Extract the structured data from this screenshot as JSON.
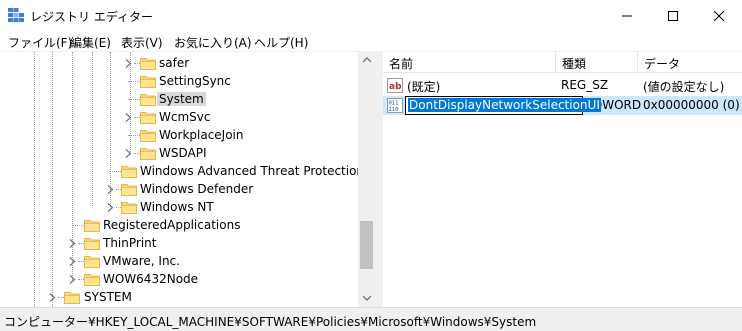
{
  "window": {
    "title": "レジストリ エディター"
  },
  "menu": [
    "ファイル(F)",
    "編集(E)",
    "表示(V)",
    "お気に入り(A)",
    "ヘルプ(H)"
  ],
  "tree": {
    "nodes": [
      {
        "label": "safer",
        "expandable": true,
        "selected": false
      },
      {
        "label": "SettingSync",
        "expandable": false,
        "selected": false
      },
      {
        "label": "System",
        "expandable": false,
        "selected": true
      },
      {
        "label": "WcmSvc",
        "expandable": true,
        "selected": false
      },
      {
        "label": "WorkplaceJoin",
        "expandable": false,
        "selected": false
      },
      {
        "label": "WSDAPI",
        "expandable": true,
        "selected": false
      },
      {
        "label": "Windows Advanced Threat Protection",
        "expandable": false,
        "selected": false
      },
      {
        "label": "Windows Defender",
        "expandable": true,
        "selected": false
      },
      {
        "label": "Windows NT",
        "expandable": true,
        "selected": false
      },
      {
        "label": "RegisteredApplications",
        "expandable": false,
        "selected": false
      },
      {
        "label": "ThinPrint",
        "expandable": true,
        "selected": false
      },
      {
        "label": "VMware, Inc.",
        "expandable": true,
        "selected": false
      },
      {
        "label": "WOW6432Node",
        "expandable": true,
        "selected": false
      },
      {
        "label": "SYSTEM",
        "expandable": true,
        "selected": false
      }
    ]
  },
  "list": {
    "columns": [
      "名前",
      "種類",
      "データ"
    ],
    "rows": [
      {
        "icon": "string-value-icon",
        "name": "(既定)",
        "type": "REG_SZ",
        "data": "(値の設定なし)",
        "selected": false
      },
      {
        "icon": "dword-value-icon",
        "name": "DontDisplayNetworkSelectionUI",
        "type": "REG_DWORD",
        "type_visible": "DWORD",
        "data": "0x00000000 (0)",
        "selected": true,
        "renaming": true
      }
    ]
  },
  "status": {
    "path": "コンピューター¥HKEY_LOCAL_MACHINE¥SOFTWARE¥Policies¥Microsoft¥Windows¥System"
  },
  "colors": {
    "selection": "#cce8ff",
    "folder": "#ffd76a",
    "rename_highlight": "#0078d7"
  }
}
